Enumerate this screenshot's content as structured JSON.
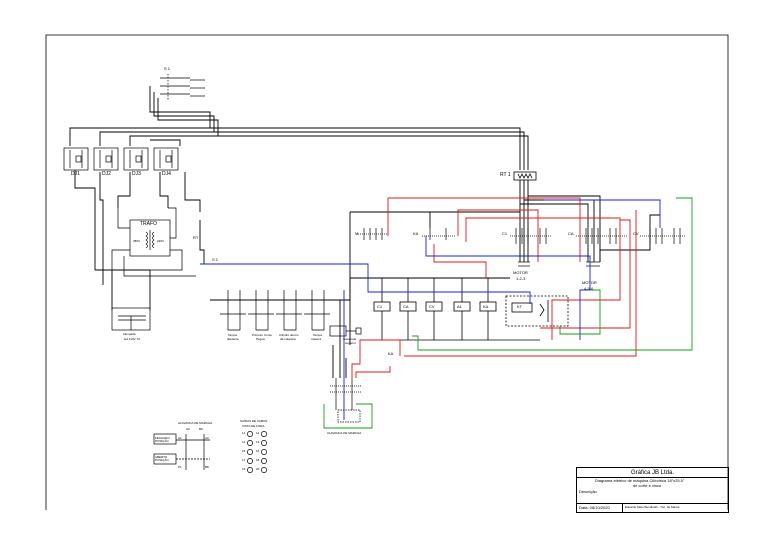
{
  "title_block": {
    "company": "Gráfica JB Ltda.",
    "description_line1": "Diagrama elétrico de máquina Cilíndrica  18\"x25.5\"",
    "description_line2": "de corte e vinco",
    "description_label": "Descrição",
    "date_label": "Data: 08/10/2020",
    "designer": "Eduardo Melo Bendinelli - Téc. de Manut."
  },
  "labels": {
    "s1": "S 1",
    "dj": [
      "DJ1",
      "DJ2",
      "DJ3",
      "DJ4"
    ],
    "rt1": "RT 1",
    "trafo": "TRAFO",
    "v380": "380V",
    "v220": "220V",
    "rt": "RT",
    "s1_sw": "S 1",
    "m": "M",
    "ka": "KA",
    "c1": "C1",
    "ca": "CA",
    "cv": "CV",
    "motor1_title": "MOTOR",
    "motor1_sub": "1-2-3",
    "motor2_title": "MOTOR",
    "motor2_sub": "4-5-6",
    "coils": [
      "C1",
      "CA",
      "CV",
      "A1",
      "KA"
    ],
    "coil_kt": "KT",
    "ka_bottom": "KA",
    "lamp_caption_1": "Lâmpada",
    "lamp_caption_2": "led 110V 7A",
    "valve_captions": [
      [
        "Tampa",
        "dianteira"
      ],
      [
        "Primeiro Curso",
        "Pegua"
      ],
      [
        "Cilindro dentro",
        "da máquina"
      ],
      [
        "Tampa",
        "traseira"
      ]
    ],
    "solenoid_caption": [
      "Solenoide",
      "superior"
    ],
    "alavanca_de_marcha": "ALAVANCA DE MARCHA",
    "legend_lever_title": "ALAVANCA DE MARCHA",
    "legend_lever_ab": "A2",
    "legend_lever_cd": "B9",
    "legend_a1": "A1",
    "legend_a3": "A3",
    "legend_p1": "P1",
    "legend_b8": "B8",
    "legend_closed": "FECHADO POSIÇÃO",
    "legend_open": "ABERTO POSIÇÃO",
    "legend_outputs_title": "SAÍDAS DE CABOS",
    "legend_outputs_sub": "VISTA DE FORA",
    "output_pins": [
      "11",
      "12",
      "13",
      "14",
      "15",
      "16",
      "17",
      "18",
      "19",
      "20"
    ]
  },
  "colors": {
    "black": "#000000",
    "red": "#e01818",
    "blue": "#1420d8",
    "green": "#12a012"
  }
}
